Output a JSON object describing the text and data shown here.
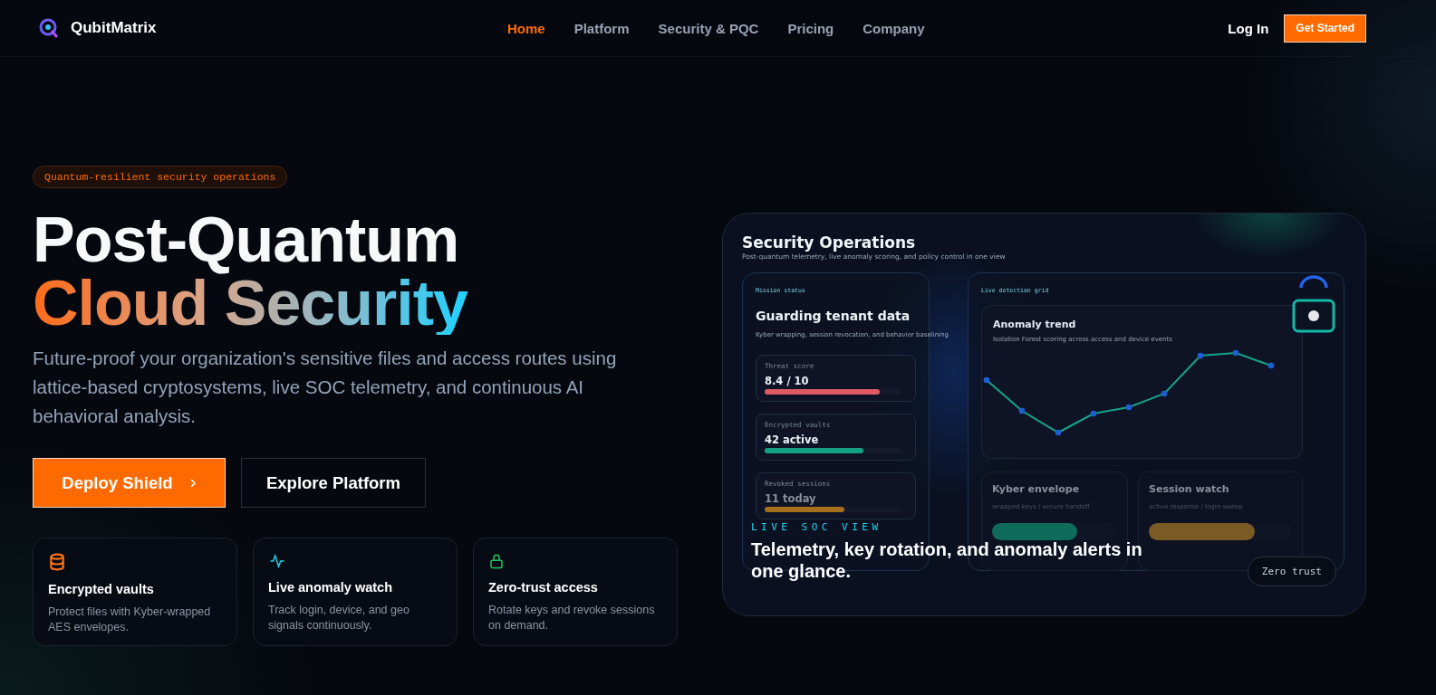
{
  "brand": {
    "name": "QubitMatrix"
  },
  "nav": {
    "links": [
      {
        "label": "Home",
        "selected": true
      },
      {
        "label": "Platform",
        "selected": false
      },
      {
        "label": "Security & PQC",
        "selected": false
      },
      {
        "label": "Pricing",
        "selected": false
      },
      {
        "label": "Company",
        "selected": false
      }
    ],
    "login": "Log In",
    "cta": "Get Started"
  },
  "hero": {
    "badge": "Quantum-resilient security operations",
    "title_line1": "Post-Quantum",
    "title_line2": "Cloud Security",
    "description": "Future-proof your organization's sensitive files and access routes using lattice-based cryptosystems, live SOC telemetry, and continuous AI behavioral analysis.",
    "buttons": [
      {
        "label": "Deploy Shield",
        "kind": "primary"
      },
      {
        "label": "Explore Platform",
        "kind": "secondary"
      }
    ],
    "features": [
      {
        "title": "Encrypted vaults",
        "description": "Protect files with Kyber-wrapped AES envelopes.",
        "color": "#f97316"
      },
      {
        "title": "Live anomaly watch",
        "description": "Track login, device, and geo signals continuously.",
        "color": "#22d3ee"
      },
      {
        "title": "Zero-trust access",
        "description": "Rotate keys and revoke sessions on demand.",
        "color": "#22c55e"
      }
    ]
  },
  "dashboard": {
    "title": "Security Operations",
    "subtitle": "Post-quantum telemetry, live anomaly scoring, and policy control in one view",
    "mission": {
      "label": "Mission status",
      "heading": "Guarding tenant data",
      "description": "Kyber wrapping, session revocation, and behavior baselining",
      "metrics": [
        {
          "label": "Threat score",
          "value": "8.4 / 10",
          "level": 0.84,
          "color": "#e05a64"
        },
        {
          "label": "Encrypted vaults",
          "value": "42 active",
          "level": 0.72,
          "color": "#14a085"
        },
        {
          "label": "Revoked sessions",
          "value": "11 today",
          "level": 0.58,
          "color": "#a66f1c"
        }
      ]
    },
    "detection": {
      "label": "Live detection grid",
      "trend": {
        "title": "Anomaly trend",
        "subtitle": "Isolation Forest scoring across access and device events"
      },
      "cards": [
        {
          "title": "Kyber envelope",
          "subtitle": "wrapped keys / secure handoff",
          "level": 0.68,
          "color": "#0f6b5a"
        },
        {
          "title": "Session watch",
          "subtitle": "active response / login sweep",
          "level": 0.74,
          "color": "#7a5a25"
        }
      ]
    },
    "overlay": {
      "eyebrow": "LIVE SOC VIEW",
      "caption": "Telemetry, key rotation, and anomaly alerts in one glance."
    },
    "pill": "Zero trust"
  }
}
